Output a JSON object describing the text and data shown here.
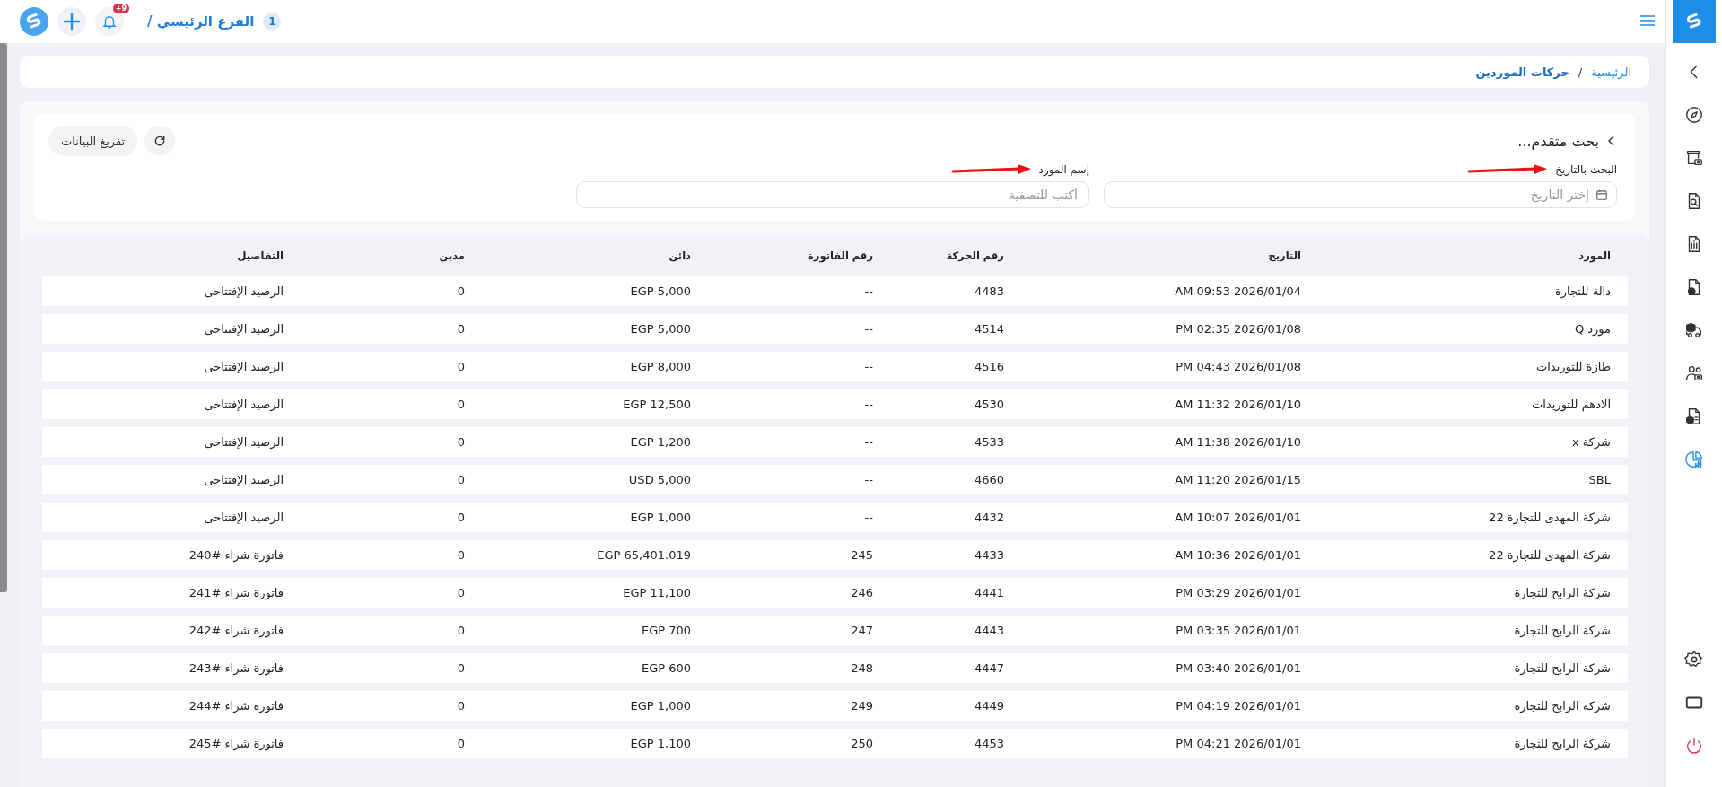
{
  "topbar": {
    "branch": "الفرع الرئيسي /",
    "branch_count": "1",
    "notifications_badge": "+9"
  },
  "sidebar": {
    "items": [
      {
        "kind": "back",
        "selected": false
      },
      {
        "kind": "compass",
        "selected": false
      },
      {
        "kind": "store",
        "selected": false
      },
      {
        "kind": "doc-search",
        "selected": false
      },
      {
        "kind": "doc-info",
        "selected": false
      },
      {
        "kind": "doc-sync",
        "selected": false
      },
      {
        "kind": "truck",
        "selected": false
      },
      {
        "kind": "users",
        "selected": false
      },
      {
        "kind": "doc-box",
        "selected": false
      },
      {
        "kind": "chart",
        "selected": true
      }
    ],
    "bottom": [
      {
        "kind": "gear"
      },
      {
        "kind": "screen"
      },
      {
        "kind": "power"
      }
    ]
  },
  "breadcrumb": {
    "separator": "/",
    "items": [
      {
        "label": "الرئيسية",
        "current": false
      },
      {
        "label": "حركات الموردين",
        "current": true
      }
    ]
  },
  "search": {
    "title": "بحث متقدم...",
    "fields": [
      {
        "kind": "date",
        "label": "البحث بالتاريخ",
        "placeholder": "إختر التاريخ",
        "marked": true
      },
      {
        "kind": "text",
        "label": "إسم المورد",
        "placeholder": "أكتب للتصفية",
        "marked": true
      }
    ],
    "clear_button": "تفريغ البيانات"
  },
  "table": {
    "columns": [
      "المورد",
      "التاريخ",
      "رقم الحركة",
      "رقم الفاتورة",
      "دائن",
      "مدين",
      "التفاصيل"
    ],
    "rows": [
      [
        "دالة للتجارة",
        "AM 09:53 2026/01/04",
        "4483",
        "--",
        "EGP 5,000",
        "0",
        "الرصيد الإفتتاحى"
      ],
      [
        "مورد Q",
        "PM 02:35 2026/01/08",
        "4514",
        "--",
        "EGP 5,000",
        "0",
        "الرصيد الإفتتاحى"
      ],
      [
        "طازة للتوريدات",
        "PM 04:43 2026/01/08",
        "4516",
        "--",
        "EGP 8,000",
        "0",
        "الرصيد الإفتتاحى"
      ],
      [
        "الادهم للتوريدات",
        "AM 11:32 2026/01/10",
        "4530",
        "--",
        "EGP 12,500",
        "0",
        "الرصيد الإفتتاحى"
      ],
      [
        "شركة x",
        "AM 11:38 2026/01/10",
        "4533",
        "--",
        "EGP 1,200",
        "0",
        "الرصيد الإفتتاحى"
      ],
      [
        "SBL",
        "AM 11:20 2026/01/15",
        "4660",
        "--",
        "USD 5,000",
        "0",
        "الرصيد الإفتتاحى"
      ],
      [
        "شركة المهدى للتجارة 22",
        "AM 10:07 2026/01/01",
        "4432",
        "--",
        "EGP 1,000",
        "0",
        "الرصيد الإفتتاحى"
      ],
      [
        "شركة المهدى للتجارة 22",
        "AM 10:36 2026/01/01",
        "4433",
        "245",
        "EGP 65,401.019",
        "0",
        "فاتورة شراء #240"
      ],
      [
        "شركة الرابح للتجارة",
        "PM 03:29 2026/01/01",
        "4441",
        "246",
        "EGP 11,100",
        "0",
        "فاتورة شراء #241"
      ],
      [
        "شركة الرابح للتجارة",
        "PM 03:35 2026/01/01",
        "4443",
        "247",
        "EGP 700",
        "0",
        "فاتورة شراء #242"
      ],
      [
        "شركة الرابح للتجارة",
        "PM 03:40 2026/01/01",
        "4447",
        "248",
        "EGP 600",
        "0",
        "فاتورة شراء #243"
      ],
      [
        "شركة الرابح للتجارة",
        "PM 04:19 2026/01/01",
        "4449",
        "249",
        "EGP 1,000",
        "0",
        "فاتورة شراء #244"
      ],
      [
        "شركة الرابح للتجارة",
        "PM 04:21 2026/01/01",
        "4453",
        "250",
        "EGP 1,100",
        "0",
        "فاتورة شراء #245"
      ]
    ]
  }
}
